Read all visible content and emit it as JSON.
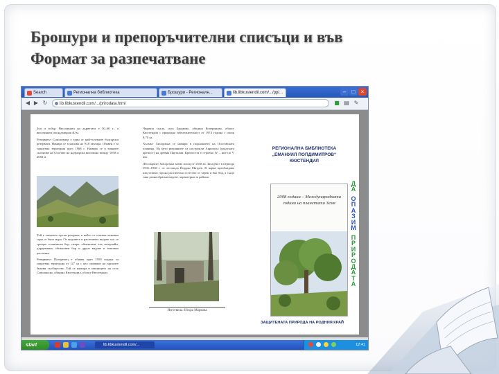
{
  "slide": {
    "title_line1": "Брошури и препоръчителни списъци и във",
    "title_line2": "Формат за разпечатване"
  },
  "browser": {
    "tabs": [
      {
        "label": "Search"
      },
      {
        "label": "Регионална библиотека"
      },
      {
        "label": "Брошури - Регионалн..."
      },
      {
        "label": "lib.libkustendil.com/.../pp/..."
      }
    ],
    "url": "lib.libkustendil.com/.../prirodata.html"
  },
  "brochure": {
    "left_text_1": "Зуп и тобър. Височината на дърветата е 50–60 г., а височината им надхвърля 40 м.",
    "left_text_2": "Резерватът Соколовица е един от най-големите български резервати. Намира се в масива на 70,8 хектара. Обявен е за защитена територия през 1968 г. Намира се в южните склонове на Осогово на надморска височина между 1050 и 2050 м.",
    "left_text_3": "Той е типичен горски резерват, в който се опазват вековни гори от бяла мура. От видовете в растенията видове тук се срещат: планински бор, смърч, обикновен, ела, валдшайн, дърдевинка, обикновен бор и други видове и типични растения.",
    "left_text_4": "Резерватът Погорелец е обявен през 1950 година за защитена територия от 127 ха с цел опазване на горските букови съобщества. Той се намира в землището на село Соволянско, община Кюстендил, област Кюстендил.",
    "mid_text_1": "Чирпата скала, село Бараково, община Кочериново, област Кюстендил с природна забележителност от 1974 година с площ 8,70 ха.",
    "mid_text_2": "Хълмът Хисарлъка се намира в подножието на Осоговската планина. На него римляните са построили Акропола (градската крепост) на древна Пауталия. Крепостта е строена IV – ние по V век.",
    "mid_text_3": "Лесопаркът Хисарлъка заема площ от 1300 ха. Засаден е в периода 1931–1938 г. от лесовъда Йордан Митрев. В парка преобладава изкуствено горско растително естество от черен и бял бор, а също така разнообразни видове, характерни за района.",
    "mid_caption": "Изготвила: Искра Маркова",
    "library_name": "РЕГИОНАЛНА БИБЛИОТЕКА „ЕМАНУИЛ ПОПДИМИТРОВ“ КЮСТЕНДИЛ",
    "cover_quote": "2008 година – Международната година на планетата Земя",
    "vertical_word_1": [
      "Д",
      "А"
    ],
    "vertical_word_2": [
      "О",
      "П",
      "А",
      "З",
      "И",
      "М"
    ],
    "vertical_word_3": [
      "П",
      "Р",
      "И",
      "Р",
      "О",
      "Д",
      "А",
      "Т",
      "А"
    ],
    "cover_bottom": "ЗАЩИТЕНАТА ПРИРОДА НА РОДНИЯ КРАЙ"
  },
  "taskbar": {
    "start_label": "start",
    "task_label": "lib.libkustendil.com/...",
    "clock": "12:41"
  },
  "colors": {
    "green_letters": "#2a9a3a",
    "blue_letters": "#2750c4",
    "title_text": "#3d3d3d"
  }
}
